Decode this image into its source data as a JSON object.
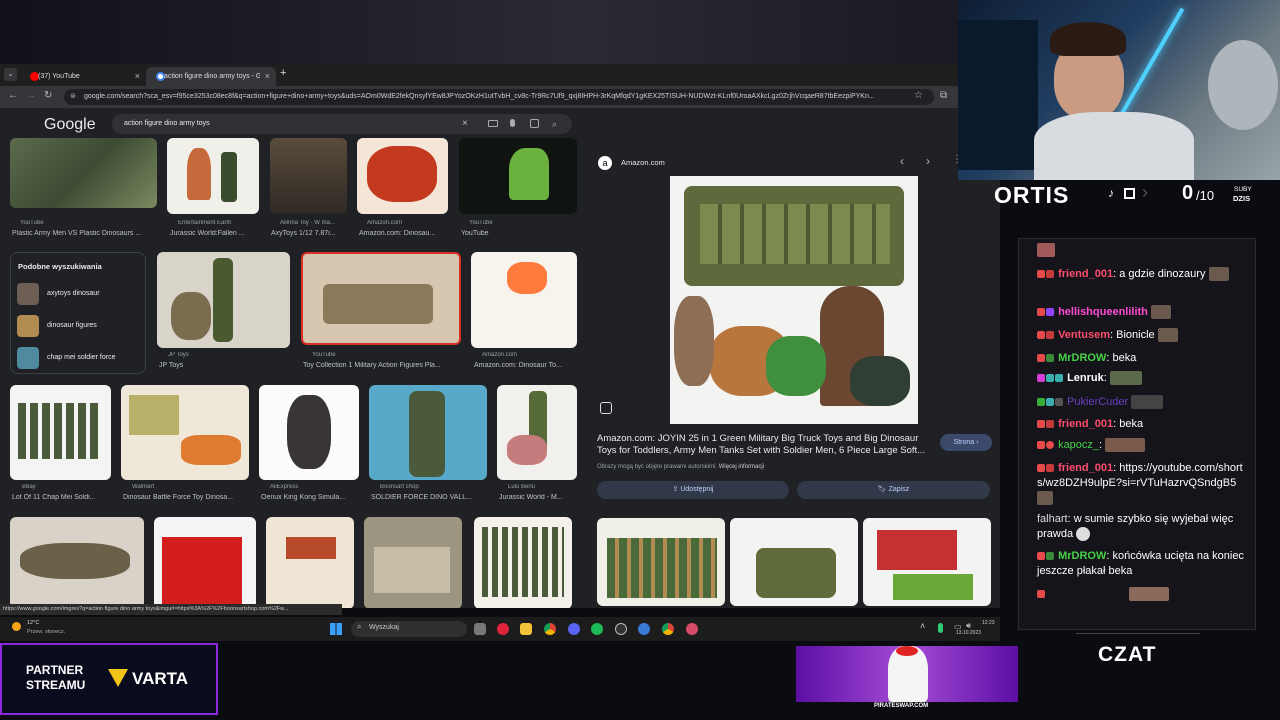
{
  "browser": {
    "tabs": [
      {
        "label": "(37) YouTube",
        "close": "×"
      },
      {
        "label": "action figure dino army toys - G",
        "close": "×"
      }
    ],
    "new_tab": "+",
    "url": "google.com/search?sca_esv=f95ce3253c08ec8f&q=action+figure+dino+army+toys&uds=AOm0WdE2fekQnsyfYEw8JPYozOKzH1utTvbH_cv8c-Tr9Rc7Uf9_qxj8IHPH-3rKqMfqdY1gKEX25TISUH-NUDWzt-KLnf0UroaAXkcLgz0ZrjhVcqaeR87tbEezpiPYKn..."
  },
  "google": {
    "logo": "Google",
    "query": "action figure dino army toys"
  },
  "results_row1": [
    {
      "source": "YouTube",
      "caption": "Plastic Army Men VS Plastic Dinosaurs ..."
    },
    {
      "source": "Entertainment Earth",
      "caption": "Jurassic World:Fallen ..."
    },
    {
      "source": "Allinna Toy · W ma...",
      "caption": "AxyToys 1/12 7.87i..."
    },
    {
      "source": "Amazon.com",
      "caption": "Amazon.com: Dinosau..."
    },
    {
      "source": "YouTube",
      "caption": "YouTube"
    }
  ],
  "related": {
    "title": "Podobne wyszukiwania",
    "items": [
      "axytoys dinosaur",
      "dinosaur figures",
      "chap mei soldier force"
    ]
  },
  "results_row2": [
    {
      "source": "JP Toys",
      "caption": "JP Toys"
    },
    {
      "source": "YouTube",
      "caption": "Toy Collection 1 Military Action Figures Pla..."
    },
    {
      "source": "Amazon.com",
      "caption": "Amazon.com: Dinosaur To..."
    }
  ],
  "results_row3": [
    {
      "source": "eBay",
      "caption": "Lot Of 11 Chap Mei Soldi..."
    },
    {
      "source": "Walmart",
      "caption": "Dinosaur Battle Force Toy Dinosa..."
    },
    {
      "source": "AliExpress",
      "caption": "Oenux King Kong Simula..."
    },
    {
      "source": "Boonsart shop",
      "caption": "SOLDIER FORCE DINO VALL..."
    },
    {
      "source": "Lulu Berlu",
      "caption": "Jurassic World - M..."
    }
  ],
  "preview": {
    "site": "Amazon.com",
    "title": "Amazon.com: JOYIN 25 in 1 Green Military Big Truck Toys and Big Dinosaur Toys for Toddlers, Army Men Tanks Set with Soldier Men, 6 Piece Large Soft...",
    "copyright": "Obrazy mogą być objęte prawami autorskimi.",
    "more_info": "Więcej informacji",
    "visit": "Strona",
    "share": "Udostępnij",
    "save": "Zapisz"
  },
  "status_url": "https://www.google.com/imgres?q=action figure dino army toys&imgurl=https%3A%2F%2Fboonsartshop.com%2Fw...",
  "taskbar": {
    "weather_temp": "12°C",
    "weather_desc": "Przew. słonecz.",
    "search": "Wyszukaj",
    "time": "12:23",
    "date": "13.10.2023"
  },
  "stream": {
    "name": "ORTIS",
    "subs_count": "0",
    "subs_goal": "/10",
    "subs_label_1": "SUBY",
    "subs_label_2": "DZIS",
    "chat_label": "CZAT",
    "partner_line1": "PARTNER",
    "partner_line2": "STREAMU",
    "sponsor": "VARTA",
    "promo_url": "PIRATESWAP.COM"
  },
  "chat": [
    {
      "user": "friend_001",
      "color": "#ff4d6d",
      "text": "a gdzie dinozaury"
    },
    {
      "user": "hellishqueenlilith",
      "color": "#ff4dd2",
      "text": ""
    },
    {
      "user": "Ventusem",
      "color": "#ff4d6d",
      "text": "Bionicle"
    },
    {
      "user": "MrDROW",
      "color": "#47d147",
      "text": "beka"
    },
    {
      "user": "Lenruk",
      "color": "#ffffff",
      "text": ""
    },
    {
      "user": "PukierCuder",
      "color": "#6b3fc1",
      "text": ""
    },
    {
      "user": "friend_001",
      "color": "#ff4d6d",
      "text": "beka"
    },
    {
      "user": "kapocz_",
      "color": "#47d147",
      "text": ""
    },
    {
      "user": "friend_001",
      "color": "#ff4d6d",
      "text": "https://youtube.com/shorts/wz8DZH9ulpE?si=rVTuHazrvQSndgB5"
    },
    {
      "user": "falhart",
      "color": "#dddddd",
      "text": "w sumie szybko się wyjebał więc prawda"
    },
    {
      "user": "MrDROW",
      "color": "#47d147",
      "text": "końcówka ucięta na koniec jeszcze płakał beka"
    }
  ],
  "colors": {
    "page_bg": "#202124",
    "accent_blue": "#8ab4f8",
    "chat_bg": "#14141a",
    "purple": "#8a2be2"
  }
}
